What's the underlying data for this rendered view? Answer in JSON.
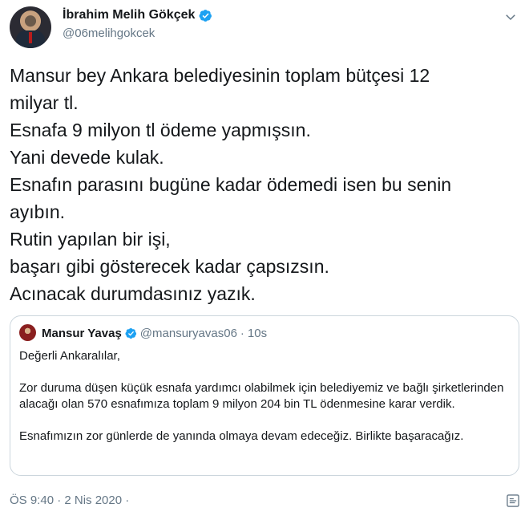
{
  "author": {
    "display_name": "İbrahim Melih Gökçek",
    "handle": "@06melihgokcek"
  },
  "tweet_lines": [
    "Mansur bey Ankara belediyesinin toplam bütçesi 12",
    "milyar tl.",
    "Esnafa 9 milyon tl ödeme yapmışsın.",
    "Yani devede kulak.",
    "Esnafın parasını bugüne kadar ödemedi isen bu senin",
    "ayıbın.",
    "Rutin yapılan bir işi,",
    "başarı gibi gösterecek kadar çapsızsın.",
    "Acınacak durumdasınız yazık."
  ],
  "quoted": {
    "display_name": "Mansur Yavaş",
    "handle": "@mansuryavas06",
    "separator": "·",
    "time": "10s",
    "paragraphs": [
      "Değerli Ankaralılar,",
      "Zor duruma düşen küçük esnafa yardımcı olabilmek için belediyemiz ve bağlı şirketlerinden alacağı olan 570 esnafımıza toplam 9 milyon 204 bin TL ödenmesine karar verdik.",
      "Esnafımızın zor günlerde de yanında olmaya devam edeceğiz. Birlikte başaracağız."
    ]
  },
  "timestamp": "ÖS 9:40 · 2 Nis 2020 ·",
  "colors": {
    "text": "#14171a",
    "secondary": "#657786",
    "verified": "#1da1f2",
    "border": "#ccd6dd"
  },
  "icons": {
    "verified": "verified-badge-icon",
    "chevron": "chevron-down-icon",
    "analytics": "analytics-icon"
  }
}
